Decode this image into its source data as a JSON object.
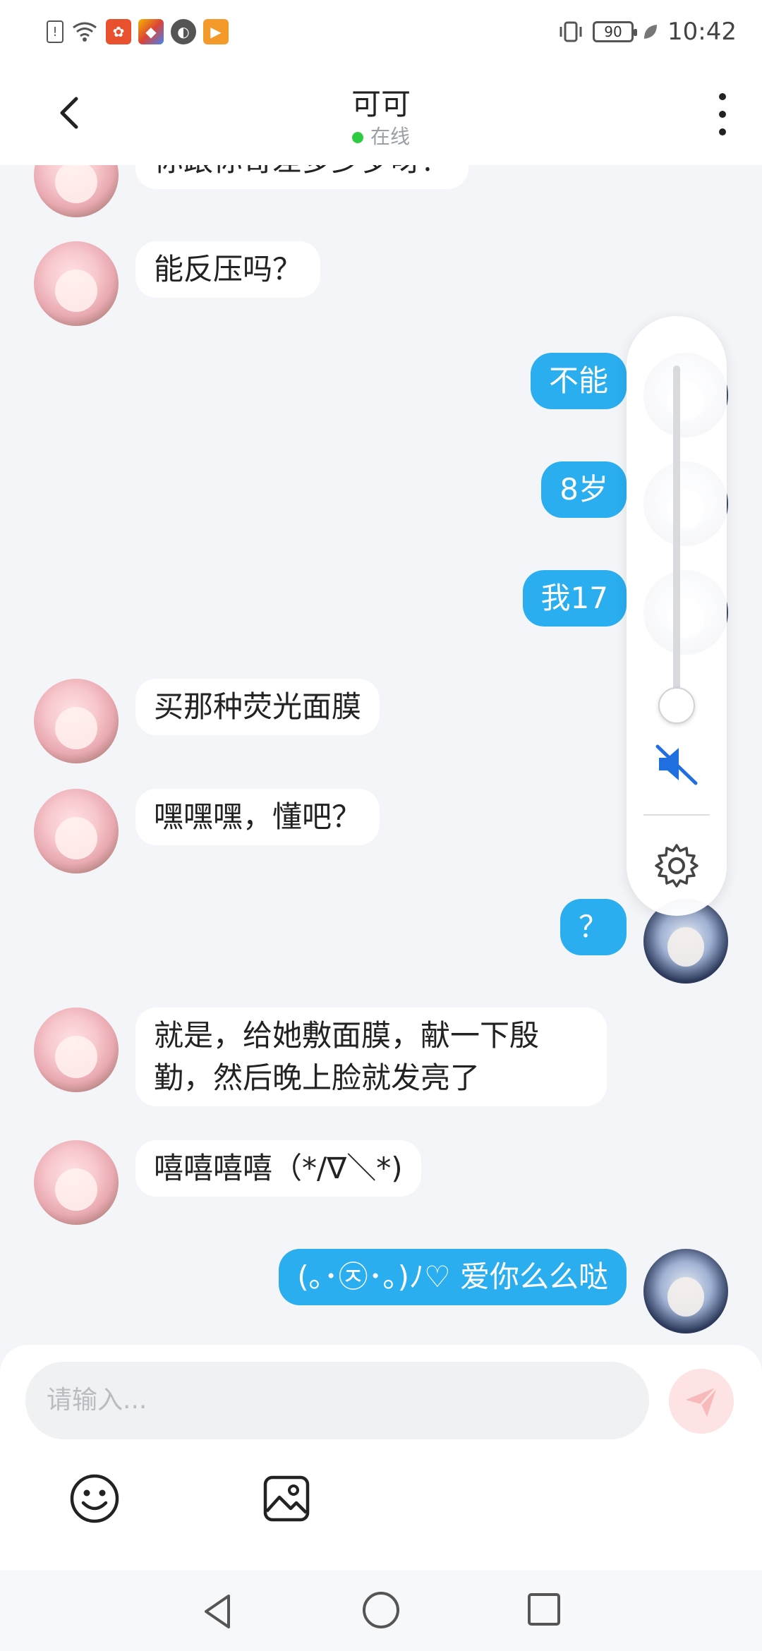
{
  "status_bar": {
    "time": "10:42",
    "battery": "90"
  },
  "header": {
    "title": "可可",
    "status": "在线"
  },
  "messages": [
    {
      "side": "left",
      "text": "你跟你哥差多少岁呀？"
    },
    {
      "side": "left",
      "text": "能反压吗？"
    },
    {
      "side": "right",
      "text": "不能"
    },
    {
      "side": "right",
      "text": "8岁"
    },
    {
      "side": "right",
      "text": "我17"
    },
    {
      "side": "left",
      "text": "买那种荧光面膜"
    },
    {
      "side": "left",
      "text": "嘿嘿嘿，懂吧？"
    },
    {
      "side": "right",
      "text": "？"
    },
    {
      "side": "left",
      "text": "就是，给她敷面膜，献一下殷勤，然后晚上脸就发亮了"
    },
    {
      "side": "left",
      "text": "嘻嘻嘻嘻（*/∇＼*)"
    },
    {
      "side": "right",
      "text": "(｡･㉨･｡)ﾉ♡ 爱你么么哒"
    }
  ],
  "volume_panel": {
    "level": 0,
    "muted": true,
    "mute_icon": "speaker-muted-icon",
    "settings_icon": "gear-icon"
  },
  "composer": {
    "placeholder": "请输入...",
    "send_icon": "send-icon",
    "emoji_icon": "smiley-icon",
    "image_icon": "image-icon"
  },
  "colors": {
    "accent": "#2aaef0",
    "online": "#2ecc40",
    "send_disabled": "#fde3e3"
  }
}
